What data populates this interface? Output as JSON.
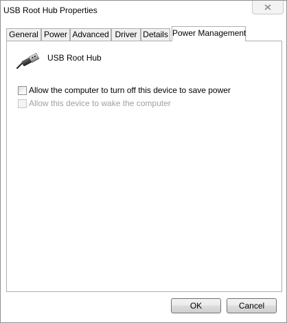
{
  "window": {
    "title": "USB Root Hub Properties"
  },
  "tabs": [
    {
      "label": "General",
      "active": false
    },
    {
      "label": "Power",
      "active": false
    },
    {
      "label": "Advanced",
      "active": false
    },
    {
      "label": "Driver",
      "active": false
    },
    {
      "label": "Details",
      "active": false
    },
    {
      "label": "Power Management",
      "active": true
    }
  ],
  "device": {
    "name": "USB Root Hub",
    "icon": "usb-plug-icon"
  },
  "options": [
    {
      "label": "Allow the computer to turn off this device to save power",
      "checked": false,
      "enabled": true
    },
    {
      "label": "Allow this device to wake the computer",
      "checked": false,
      "enabled": false
    }
  ],
  "buttons": {
    "ok": "OK",
    "cancel": "Cancel"
  }
}
